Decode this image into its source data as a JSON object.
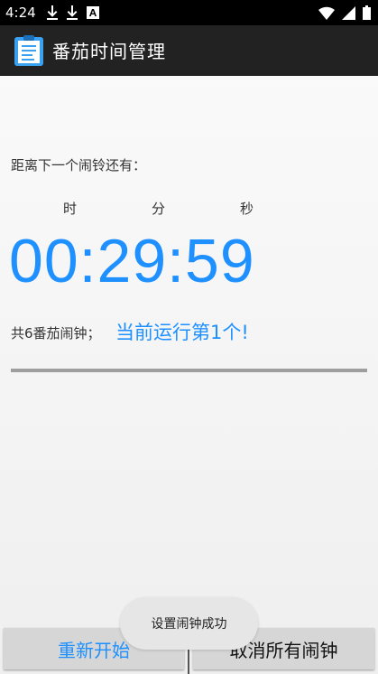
{
  "status_bar": {
    "time": "4:24",
    "icons": [
      "download-icon",
      "download-icon",
      "text-a-icon",
      "wifi-icon",
      "signal-icon",
      "battery-icon"
    ]
  },
  "app_bar": {
    "title": "番茄时间管理",
    "icon": "clipboard-icon"
  },
  "timer": {
    "label": "距离下一个闹铃还有：",
    "unit_hours": "时",
    "unit_minutes": "分",
    "unit_seconds": "秒",
    "countdown": "00:29:59"
  },
  "summary": {
    "total_text": "共6番茄闹钟；",
    "running_text": "当前运行第1个!"
  },
  "progress": {
    "fraction": 0
  },
  "buttons": {
    "restart": "重新开始",
    "cancel_all": "取消所有闹钟"
  },
  "toast": {
    "text": "设置闹钟成功"
  },
  "colors": {
    "accent": "#1e90ff",
    "status_bar": "#000000",
    "app_bar": "#222222"
  }
}
